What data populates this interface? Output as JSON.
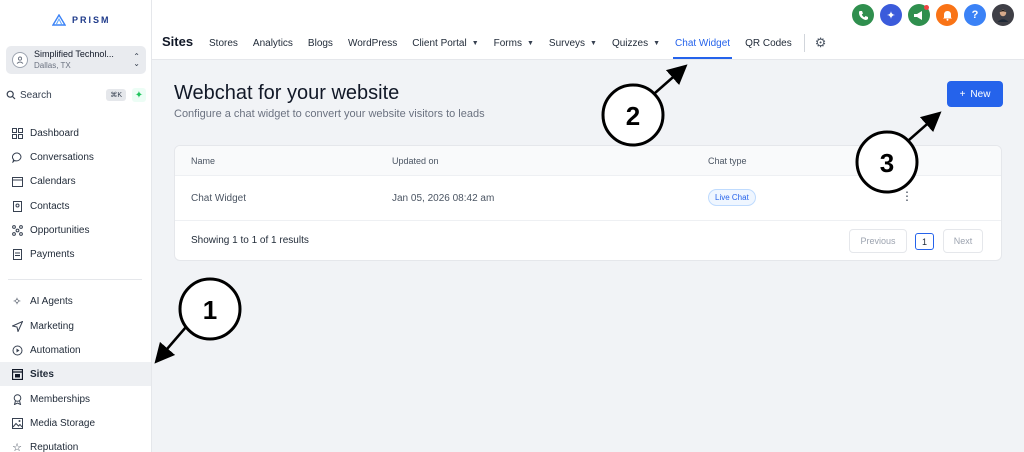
{
  "sidebar": {
    "logo": "PRISM",
    "account": {
      "name": "Simplified Technol...",
      "location": "Dallas, TX"
    },
    "search": {
      "label": "Search",
      "shortcut": "⌘K"
    },
    "items": [
      {
        "label": "Dashboard",
        "icon": "dashboard-icon"
      },
      {
        "label": "Conversations",
        "icon": "chat-icon"
      },
      {
        "label": "Calendars",
        "icon": "calendar-icon"
      },
      {
        "label": "Contacts",
        "icon": "contacts-icon"
      },
      {
        "label": "Opportunities",
        "icon": "opportunities-icon"
      },
      {
        "label": "Payments",
        "icon": "payments-icon"
      },
      {
        "label": "AI Agents",
        "icon": "sparkle-icon"
      },
      {
        "label": "Marketing",
        "icon": "send-icon"
      },
      {
        "label": "Automation",
        "icon": "automation-icon"
      },
      {
        "label": "Sites",
        "icon": "sites-icon",
        "active": true
      },
      {
        "label": "Memberships",
        "icon": "memberships-icon"
      },
      {
        "label": "Media Storage",
        "icon": "image-icon"
      },
      {
        "label": "Reputation",
        "icon": "star-icon"
      }
    ]
  },
  "header": {
    "title": "Sites",
    "tabs": [
      {
        "label": "Stores"
      },
      {
        "label": "Analytics"
      },
      {
        "label": "Blogs"
      },
      {
        "label": "WordPress"
      },
      {
        "label": "Client Portal",
        "dropdown": true
      },
      {
        "label": "Forms",
        "dropdown": true
      },
      {
        "label": "Surveys",
        "dropdown": true
      },
      {
        "label": "Quizzes",
        "dropdown": true
      },
      {
        "label": "Chat Widget",
        "active": true
      },
      {
        "label": "QR Codes"
      }
    ],
    "top_icons": [
      {
        "name": "phone-icon",
        "color": "#2f8f4e"
      },
      {
        "name": "magic-icon",
        "color": "#3b5bdb"
      },
      {
        "name": "megaphone-icon",
        "color": "#2f8f4e"
      },
      {
        "name": "bell-icon",
        "color": "#f97316"
      },
      {
        "name": "help-icon",
        "color": "#3b82f6",
        "glyph": "?"
      },
      {
        "name": "user-avatar",
        "color": "#3f3f46"
      }
    ]
  },
  "main": {
    "title": "Webchat for your website",
    "subtitle": "Configure a chat widget to convert your website visitors to leads",
    "new_button": "New",
    "table": {
      "columns": [
        "Name",
        "Updated on",
        "Chat type"
      ],
      "rows": [
        {
          "name": "Chat Widget",
          "updated": "Jan 05, 2026 08:42 am",
          "type": "Live Chat"
        }
      ],
      "results_text": "Showing 1 to 1 of 1 results",
      "previous": "Previous",
      "page": "1",
      "next": "Next"
    }
  },
  "annotations": [
    "1",
    "2",
    "3"
  ],
  "colors": {
    "accent": "#2563eb"
  }
}
